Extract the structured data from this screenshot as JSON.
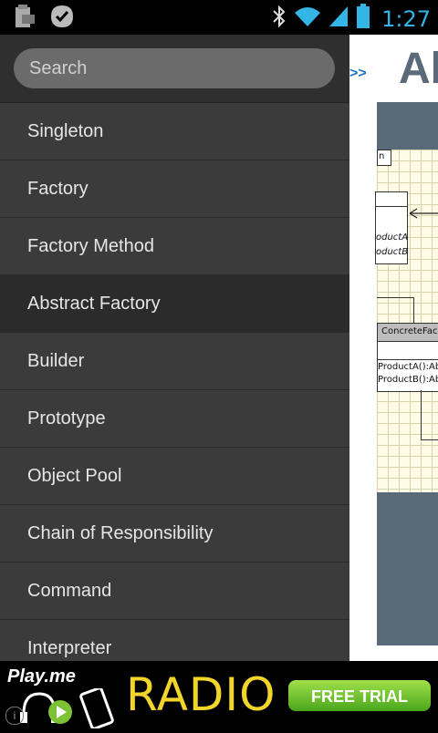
{
  "status_bar": {
    "time": "1:27",
    "icons": [
      "sd-card-icon",
      "check-badge-icon",
      "bluetooth-icon",
      "wifi-icon",
      "signal-icon",
      "battery-icon"
    ]
  },
  "drawer": {
    "search_placeholder": "Search",
    "items": [
      {
        "label": "Singleton"
      },
      {
        "label": "Factory"
      },
      {
        "label": "Factory Method"
      },
      {
        "label": "Abstract Factory",
        "active": true
      },
      {
        "label": "Builder"
      },
      {
        "label": "Prototype"
      },
      {
        "label": "Object Pool"
      },
      {
        "label": "Chain of Responsibility"
      },
      {
        "label": "Command"
      },
      {
        "label": "Interpreter"
      }
    ]
  },
  "content": {
    "nav_arrows": ">>",
    "title": "Ab",
    "diagram": {
      "tab_text": "n",
      "product_a": "oductA",
      "product_b": "oductB",
      "concrete": "ConcreteFac",
      "method_a": "ProductA():Abs",
      "method_b": "ProductB():Abs"
    }
  },
  "ad": {
    "brand": "Play.me",
    "headline": "RADIO",
    "cta": "FREE TRIAL",
    "info": "i"
  },
  "colors": {
    "accent": "#33b5e5",
    "drawer_bg": "#3b3b3b",
    "title": "#5b6a78",
    "ad_yellow": "#f2d52b",
    "cta_green": "#4aa61c"
  }
}
